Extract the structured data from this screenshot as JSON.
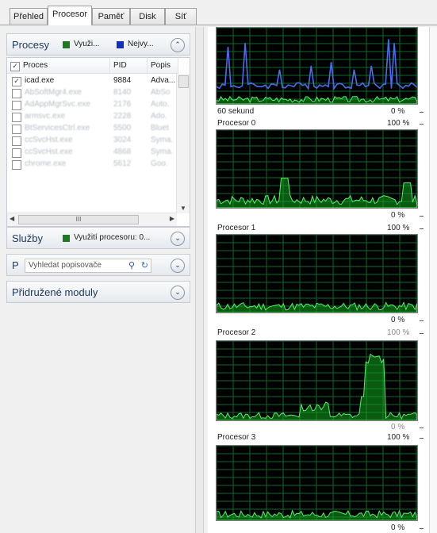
{
  "tabs": [
    {
      "label": "Přehled",
      "active": false
    },
    {
      "label": "Procesor",
      "active": true
    },
    {
      "label": "Paměť",
      "active": false
    },
    {
      "label": "Disk",
      "active": false
    },
    {
      "label": "Síť",
      "active": false
    }
  ],
  "processes": {
    "title": "Procesy",
    "legend_usage": "Využi...",
    "legend_max": "Nejvy...",
    "columns": [
      "Proces",
      "PID",
      "Popis"
    ],
    "rows": [
      {
        "name": "icad.exe",
        "pid": "9884",
        "desc": "Adva...",
        "checked": true
      },
      {
        "name": "AbSoftMgr4.exe",
        "pid": "8140",
        "desc": "AbSo",
        "checked": false
      },
      {
        "name": "AdAppMgrSvc.exe",
        "pid": "2176",
        "desc": "Auto.",
        "checked": false
      },
      {
        "name": "armsvc.exe",
        "pid": "2228",
        "desc": "Ado.",
        "checked": false
      },
      {
        "name": "BtServicesCtrl.exe",
        "pid": "5500",
        "desc": "Bluet",
        "checked": false
      },
      {
        "name": "ccSvcHst.exe",
        "pid": "3024",
        "desc": "Syma.",
        "checked": false
      },
      {
        "name": "ccSvcHst.exe",
        "pid": "4868",
        "desc": "Syma.",
        "checked": false
      },
      {
        "name": "chrome.exe",
        "pid": "5612",
        "desc": "Goo.",
        "checked": false
      }
    ],
    "hscroll_label": "III"
  },
  "services": {
    "title": "Služby",
    "legend": "Využití procesoru: 0..."
  },
  "handles": {
    "title": "P",
    "search_placeholder": "Vyhledat popisovače"
  },
  "modules": {
    "title": "Přidružené moduly"
  },
  "top_graph": {
    "time_label": "60 sekund",
    "min_label": "0 %"
  },
  "cpu_graphs": [
    {
      "name": "Procesor 0",
      "max_label": "100 %",
      "min_label": "0 %"
    },
    {
      "name": "Procesor 1",
      "max_label": "100 %",
      "min_label": "0 %"
    },
    {
      "name": "Procesor 2",
      "max_label": "100 %",
      "min_label": "0 %"
    },
    {
      "name": "Procesor 3",
      "max_label": "100 %",
      "min_label": "0 %"
    }
  ],
  "colors": {
    "graph_bg": "#000000",
    "grid": "#0b6b2b",
    "fill": "#12a51f",
    "fill_line": "#5cf06a",
    "blue_line": "#4a6cf0"
  },
  "icons": [
    "chevron-up-icon",
    "chevron-down-icon",
    "search-icon",
    "refresh-icon"
  ]
}
